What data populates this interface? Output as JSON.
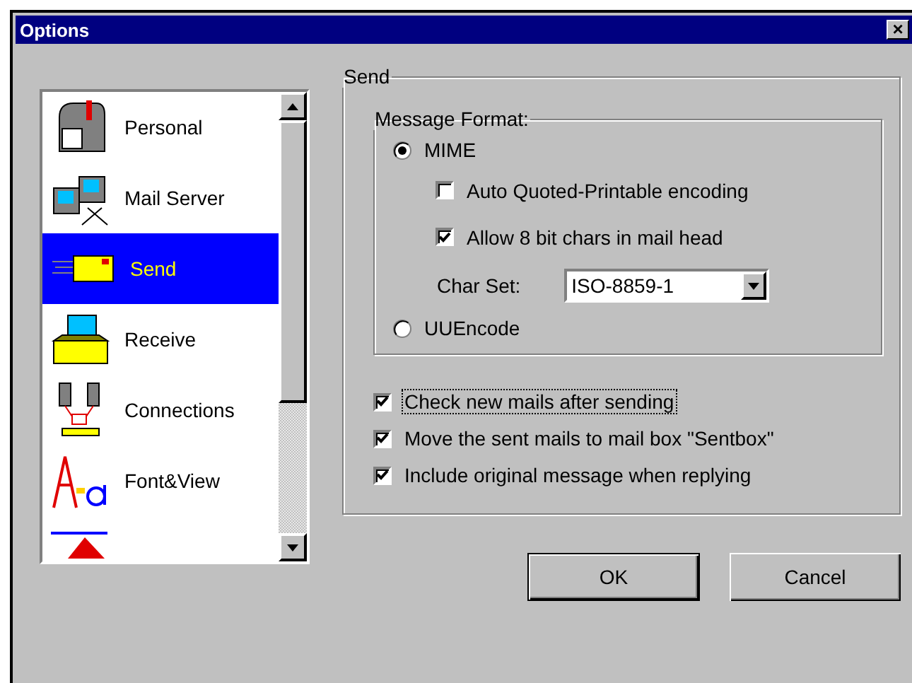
{
  "window": {
    "title": "Options",
    "close": "×"
  },
  "sidebar": {
    "items": [
      {
        "label": "Personal",
        "selected": false
      },
      {
        "label": "Mail Server",
        "selected": false
      },
      {
        "label": "Send",
        "selected": true
      },
      {
        "label": "Receive",
        "selected": false
      },
      {
        "label": "Connections",
        "selected": false
      },
      {
        "label": "Font&View",
        "selected": false
      },
      {
        "selected": false
      }
    ]
  },
  "send_group": {
    "title": "Send",
    "message_format": {
      "title": "Message Format:",
      "radios": [
        {
          "label": "MIME",
          "selected": true
        },
        {
          "label": "UUEncode",
          "selected": false
        }
      ],
      "mime_options": [
        {
          "label": "Auto Quoted-Printable encoding",
          "checked": false
        },
        {
          "label": "Allow 8 bit chars in mail head",
          "checked": true
        }
      ],
      "charset": {
        "label": "Char Set:",
        "value": "ISO-8859-1"
      }
    },
    "options": [
      {
        "label": "Check new mails after sending",
        "checked": true,
        "focused": true
      },
      {
        "label": "Move the sent mails to mail box \"Sentbox\"",
        "checked": true,
        "focused": false
      },
      {
        "label": "Include original message when replying",
        "checked": true,
        "focused": false
      }
    ]
  },
  "buttons": [
    {
      "label": "OK",
      "default": true
    },
    {
      "label": "Cancel",
      "default": false
    }
  ]
}
